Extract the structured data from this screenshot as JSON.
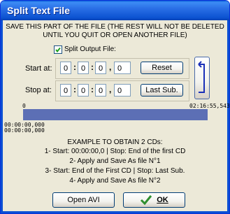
{
  "window": {
    "title": "Split Text File"
  },
  "header": {
    "line1": "SAVE THIS PART OF THE FILE (THE REST WILL NOT BE DELETED",
    "line2": "UNTIL YOU QUIT OR OPEN ANOTHER FILE)"
  },
  "split_output": {
    "label": "Split Output File:",
    "checked": true
  },
  "start": {
    "label": "Start at:",
    "h": "0",
    "m": "0",
    "s": "0",
    "f": "0",
    "button": "Reset"
  },
  "stop": {
    "label": "Stop at:",
    "h": "0",
    "m": "0",
    "s": "0",
    "f": "0",
    "button": "Last Sub."
  },
  "timeline": {
    "start_label": "0",
    "end_label": "02:16:55,543",
    "time1": "00:00:00,000",
    "time2": "00:00:00,000"
  },
  "example": {
    "heading": "EXAMPLE TO OBTAIN 2 CDs:",
    "step1": "1- Start: 00:00:00,0 | Stop: End of the first CD",
    "step2": "2- Apply and Save As file N°1",
    "step3": "3- Start: End of the First CD | Stop: Last Sub.",
    "step4": "4- Apply and Save As file N°2"
  },
  "footer": {
    "open_avi": "Open AVI",
    "ok": "OK"
  },
  "colors": {
    "titlebar": "#0b52d0",
    "timeline_bar": "#5c6fb5",
    "ok_check": "#2f8f2f"
  }
}
